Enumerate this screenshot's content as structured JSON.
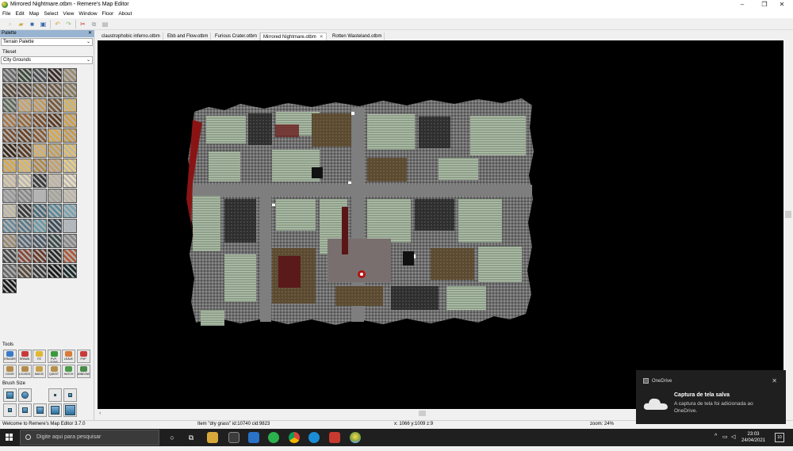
{
  "window": {
    "title": "Mirrored Nightmare.otbm - Remere's Map Editor",
    "minimize_glyph": "–",
    "maximize_glyph": "❐",
    "close_glyph": "✕"
  },
  "menu": [
    "File",
    "Edit",
    "Map",
    "Select",
    "View",
    "Window",
    "Floor",
    "About"
  ],
  "tabs": [
    {
      "label": "claustrophobic inferno.otbm",
      "active": false
    },
    {
      "label": "Ebb and Flow.otbm",
      "active": false
    },
    {
      "label": "Furious Crater.otbm",
      "active": false
    },
    {
      "label": "Mirrored Nightmare.otbm",
      "active": true,
      "close": "✕"
    },
    {
      "label": "Rotten Wasteland.otbm",
      "active": false
    }
  ],
  "palette": {
    "header": "Palette",
    "close_glyph": "✕",
    "palette_select": "Terrain Palette",
    "tileset_label": "Tileset",
    "tileset_select": "City Grounds",
    "tools_label": "Tools",
    "brush_size_label": "Brush Size",
    "tools": [
      "ERASER",
      "SPAWN",
      "PZ",
      "PVP-ZONE",
      "LEAVE",
      "PVP",
      "DOOR",
      "LOCKED",
      "MAGIC",
      "QUEST",
      "HATCH",
      "WINDOW"
    ]
  },
  "status": {
    "left": "Welcome to Remere's Map Editor 3.7.0",
    "item": "Item \"dry grass\" id:10740 cid:9823",
    "coords": "x: 1066 y:1009 z:9",
    "zoom": "zoom: 24%"
  },
  "taskbar": {
    "search_placeholder": "Digite aqui para pesquisar",
    "time": "23:03",
    "date": "24/04/2021",
    "notification_count": "10"
  },
  "notification": {
    "source": "OneDrive",
    "close_glyph": "✕",
    "title": "Captura de tela salva",
    "message": "A captura de tela foi adicionada ao OneDrive."
  },
  "colors": {
    "canvas_bg": "#000000",
    "titlebar": "#ffffff",
    "taskbar": "#1f1f1f",
    "palette_header": "#99b4d1",
    "notification_bg": "#1f1f1f"
  }
}
